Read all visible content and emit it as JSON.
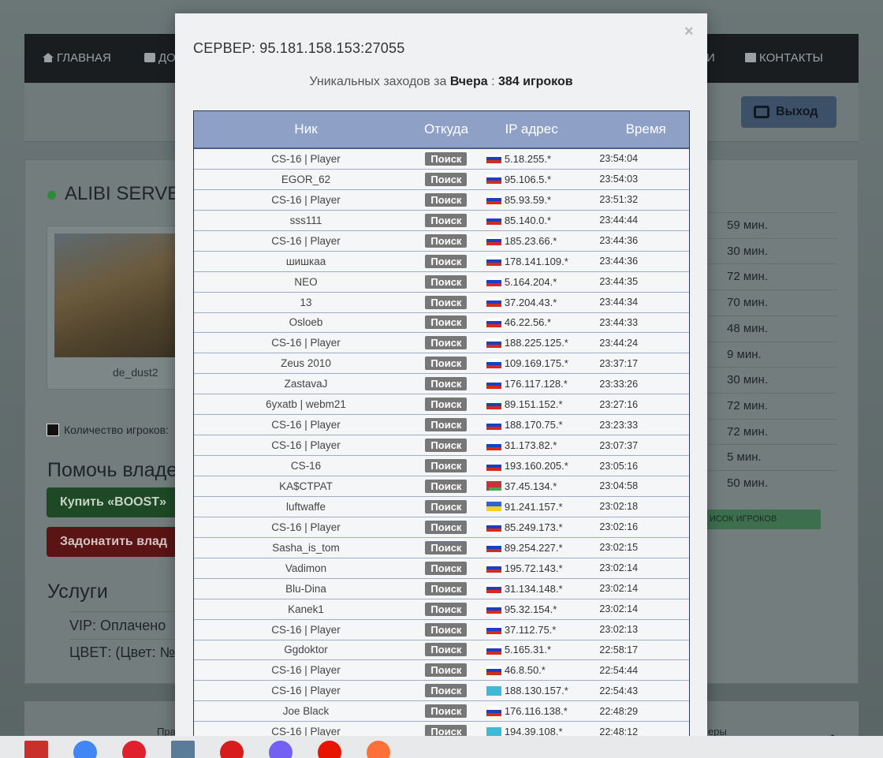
{
  "nav": {
    "home": "ГЛАВНАЯ",
    "add": "ДО",
    "hidden_right": "И",
    "contacts": "КОНТАКТЫ"
  },
  "logout_label": "Выход",
  "server": {
    "name": "ALIBI SERVER",
    "map_name": "de_dust2",
    "players_label": "Количество игроков:"
  },
  "help_title": "Помочь владе",
  "boost_label": "Купить «BOOST»",
  "donate_label": "Задонатить влад",
  "services": {
    "title": "Услуги",
    "vip": "VIP:   Оплачено",
    "color": "ЦВЕТ:   (Цвет: №"
  },
  "right_times": [
    "59 мин.",
    "30 мин.",
    "72 мин.",
    "70 мин.",
    "48 мин.",
    "9 мин.",
    "30 мин.",
    "72 мин.",
    "72 мин.",
    "5 мин.",
    "50 мин."
  ],
  "list_button": "ИСОК ИГРОКОВ",
  "footer": {
    "left": "Пра",
    "right": "еры"
  },
  "modal": {
    "close": "×",
    "title": "СЕРВЕР: 95.181.158.153:27055",
    "sub_prefix": "Уникальных заходов за",
    "sub_period": "Вчера",
    "sub_sep": ":",
    "sub_count": "384 игроков",
    "columns": [
      "Ник",
      "Откуда",
      "IP адрес",
      "Время"
    ],
    "search_label": "Поиск",
    "rows": [
      {
        "nick": "CS-16 | Player",
        "flag": "ru",
        "ip": "5.18.255.*",
        "time": "23:54:04"
      },
      {
        "nick": "EGOR_62",
        "flag": "ru",
        "ip": "95.106.5.*",
        "time": "23:54:03"
      },
      {
        "nick": "CS-16 | Player",
        "flag": "ru",
        "ip": "85.93.59.*",
        "time": "23:51:32"
      },
      {
        "nick": "sss111",
        "flag": "ru",
        "ip": "85.140.0.*",
        "time": "23:44:44"
      },
      {
        "nick": "CS-16 | Player",
        "flag": "ru",
        "ip": "185.23.66.*",
        "time": "23:44:36"
      },
      {
        "nick": "шишкаа",
        "flag": "ru",
        "ip": "178.141.109.*",
        "time": "23:44:36"
      },
      {
        "nick": "NEO",
        "flag": "ru",
        "ip": "5.164.204.*",
        "time": "23:44:35"
      },
      {
        "nick": "13",
        "flag": "ru",
        "ip": "37.204.43.*",
        "time": "23:44:34"
      },
      {
        "nick": "Osloeb",
        "flag": "ru",
        "ip": "46.22.56.*",
        "time": "23:44:33"
      },
      {
        "nick": "CS-16 | Player",
        "flag": "ru",
        "ip": "188.225.125.*",
        "time": "23:44:24"
      },
      {
        "nick": "Zeus 2010",
        "flag": "ru",
        "ip": "109.169.175.*",
        "time": "23:37:17"
      },
      {
        "nick": "ZastavaJ",
        "flag": "ru",
        "ip": "176.117.128.*",
        "time": "23:33:26"
      },
      {
        "nick": "6yxatb | webm21",
        "flag": "ru",
        "ip": "89.151.152.*",
        "time": "23:27:16"
      },
      {
        "nick": "CS-16 | Player",
        "flag": "ru",
        "ip": "188.170.75.*",
        "time": "23:23:33"
      },
      {
        "nick": "CS-16 | Player",
        "flag": "ru",
        "ip": "31.173.82.*",
        "time": "23:07:37"
      },
      {
        "nick": "CS-16",
        "flag": "ru",
        "ip": "193.160.205.*",
        "time": "23:05:16"
      },
      {
        "nick": "KA$CTPAT",
        "flag": "by",
        "ip": "37.45.134.*",
        "time": "23:04:58"
      },
      {
        "nick": "luftwaffe",
        "flag": "ua",
        "ip": "91.241.157.*",
        "time": "23:02:18"
      },
      {
        "nick": "CS-16 | Player",
        "flag": "ru",
        "ip": "85.249.173.*",
        "time": "23:02:16"
      },
      {
        "nick": "Sasha_is_tom",
        "flag": "ru",
        "ip": "89.254.227.*",
        "time": "23:02:15"
      },
      {
        "nick": "Vadimon",
        "flag": "ru",
        "ip": "195.72.143.*",
        "time": "23:02:14"
      },
      {
        "nick": "Blu-Dina",
        "flag": "ru",
        "ip": "31.134.148.*",
        "time": "23:02:14"
      },
      {
        "nick": "Kanek1",
        "flag": "ru",
        "ip": "95.32.154.*",
        "time": "23:02:14"
      },
      {
        "nick": "CS-16 | Player",
        "flag": "ru",
        "ip": "37.112.75.*",
        "time": "23:02:13"
      },
      {
        "nick": "Ggdoktor",
        "flag": "ru",
        "ip": "5.165.31.*",
        "time": "22:58:17"
      },
      {
        "nick": "CS-16 | Player",
        "flag": "ru",
        "ip": "46.8.50.*",
        "time": "22:54:44"
      },
      {
        "nick": "CS-16 | Player",
        "flag": "kz",
        "ip": "188.130.157.*",
        "time": "22:54:43"
      },
      {
        "nick": "Joe Black",
        "flag": "ru",
        "ip": "176.116.138.*",
        "time": "22:48:29"
      },
      {
        "nick": "CS-16 | Player",
        "flag": "kz",
        "ip": "194.39.108.*",
        "time": "22:48:12"
      }
    ]
  },
  "taskbar": [
    {
      "icon": "filezilla-icon",
      "color": "#c9302c"
    },
    {
      "icon": "chrome-icon",
      "color": "#4285f4"
    },
    {
      "icon": "opera-icon",
      "color": "#e0202c"
    },
    {
      "icon": "calculator-icon",
      "color": "#5b7c99"
    },
    {
      "icon": "recorder-icon",
      "color": "#d81b1b"
    },
    {
      "icon": "viber-icon",
      "color": "#7360f2"
    },
    {
      "icon": "yandex-icon",
      "color": "#e61400"
    },
    {
      "icon": "firefox-icon",
      "color": "#ff7139"
    }
  ],
  "colors": {
    "table_header": "#8fa0c6",
    "search_button": "#777777",
    "boost": "#1d4a24",
    "donate": "#5a1414"
  }
}
